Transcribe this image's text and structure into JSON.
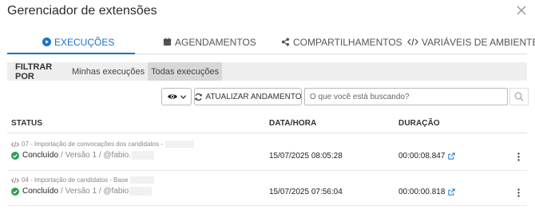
{
  "dialog": {
    "title": "Gerenciador de extensões",
    "close_icon": "close-icon"
  },
  "tabs": [
    {
      "label": "EXECUÇÕES",
      "icon": "play-circle-icon",
      "active": true
    },
    {
      "label": "AGENDAMENTOS",
      "icon": "calendar-icon",
      "active": false
    },
    {
      "label": "COMPARTILHAMENTOS",
      "icon": "share-icon",
      "active": false
    },
    {
      "label": "VARIÁVEIS DE AMBIENTE",
      "icon": "code-icon",
      "active": false
    }
  ],
  "filter": {
    "label": "FILTRAR POR",
    "options": [
      {
        "label": "Minhas execuções",
        "selected": false
      },
      {
        "label": "Todas execuções",
        "selected": true
      }
    ]
  },
  "toolbar": {
    "view_icon": "eye-icon",
    "refresh_label": "ATUALIZAR ANDAMENTO",
    "refresh_icon": "refresh-icon",
    "search_placeholder": "O que você está buscando?",
    "search_icon": "search-icon"
  },
  "table": {
    "columns": [
      "STATUS",
      "DATA/HORA",
      "DURAÇÃO"
    ],
    "rows": [
      {
        "name": "07 - Importação de convocações dos candidatos -",
        "status": "Concluído",
        "meta": "/ Versão 1 / @fabio.",
        "datetime": "15/07/2025 08:05:28",
        "duration": "00:00:08.847"
      },
      {
        "name": "04 - Importação de candidatos - Base",
        "status": "Concluído",
        "meta": "/ Versão 1 / @fabio",
        "datetime": "15/07/2025 07:56:04",
        "duration": "00:00:00.818"
      }
    ]
  },
  "colors": {
    "accent": "#1a73c8",
    "success": "#2e9e4f",
    "filter_bg": "#eeeeee",
    "filter_selected_bg": "#d7d7d7"
  }
}
